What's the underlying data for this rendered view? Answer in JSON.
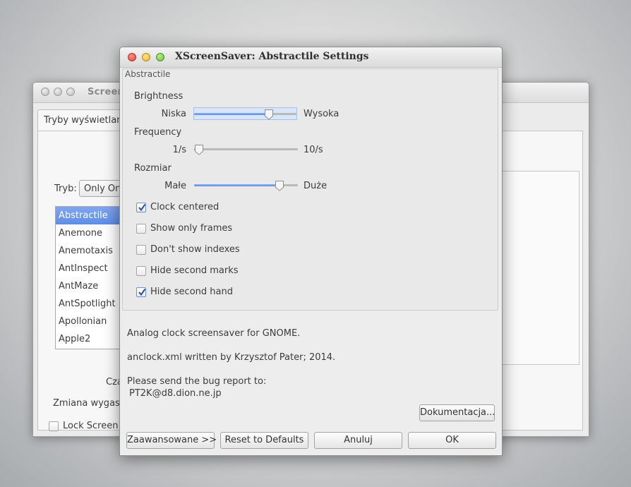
{
  "background_window": {
    "title": "Screen",
    "tab_label": "Tryby wyświetlania",
    "mode_label": "Tryb:",
    "mode_value": "Only One",
    "list_items": [
      "Abstractile",
      "Anemone",
      "Anemotaxis",
      "AntInspect",
      "AntMaze",
      "AntSpotlight",
      "Apollonian",
      "Apple2"
    ],
    "selected_item": "Abstractile",
    "label_time": "Cza",
    "label_change": "Zmiana wygasza",
    "lock_label": "Lock Screen A"
  },
  "dialog": {
    "title": "XScreenSaver: Abstractile Settings",
    "frame_title": "Abstractile",
    "sliders": [
      {
        "section": "Brightness",
        "min_label": "Niska",
        "max_label": "Wysoka",
        "level": 0.72,
        "focused": true
      },
      {
        "section": "Frequency",
        "min_label": "1/s",
        "max_label": "10/s",
        "level": 0.05,
        "focused": false
      },
      {
        "section": "Rozmiar",
        "min_label": "Małe",
        "max_label": "Duże",
        "level": 0.82,
        "focused": false
      }
    ],
    "checkboxes": [
      {
        "label": "Clock centered",
        "checked": true
      },
      {
        "label": "Show only frames",
        "checked": false
      },
      {
        "label": "Don't show indexes",
        "checked": false
      },
      {
        "label": "Hide second marks",
        "checked": false
      },
      {
        "label": "Hide second hand",
        "checked": true
      }
    ],
    "description_1": "Analog clock screensaver for GNOME.",
    "description_2": "anclock.xml written by Krzysztof Pater; 2014.",
    "description_3": "Please send the bug report to:",
    "description_4": "PT2K@d8.dion.ne.jp",
    "doc_button": "Dokumentacja...",
    "advanced_button": "Zaawansowane >>",
    "reset_button": "Reset to Defaults",
    "cancel_button": "Anuluj",
    "ok_button": "OK"
  },
  "colors": {
    "accent": "#5f8de6",
    "selection_text": "#ffffff"
  }
}
